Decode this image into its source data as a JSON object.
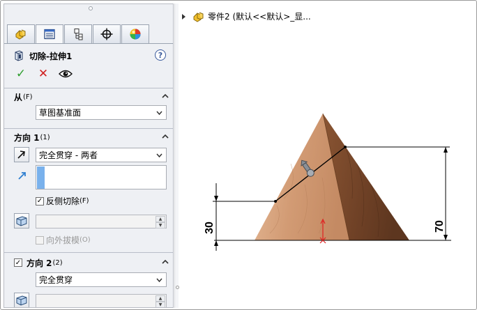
{
  "feature": {
    "title": "切除-拉伸1",
    "help": "?"
  },
  "actions": {
    "ok": "✓",
    "cancel": "✕"
  },
  "from": {
    "title": "从",
    "hotkey": "(F)",
    "value": "草图基准面"
  },
  "direction1": {
    "title": "方向 1",
    "hotkey": "(1)",
    "end_condition": "完全贯穿 - 两者",
    "flip_side_label": "反侧切除",
    "flip_side_hotkey": "(F)",
    "flip_side_checked": true,
    "draft_outward_label": "向外拔模",
    "draft_outward_hotkey": "(O)",
    "draft_value": ""
  },
  "direction2": {
    "title": "方向 2",
    "hotkey": "(2)",
    "enabled": true,
    "end_condition": "完全贯穿"
  },
  "tree": {
    "breadcrumb": "零件2  (默认<<默认>_显..."
  },
  "dimensions": {
    "left": "30",
    "right": "70"
  },
  "colors": {
    "wood_light": "#d6a47e",
    "wood_dark": "#7a4a2e",
    "dimension_line": "#000000",
    "origin": "#e02020"
  }
}
